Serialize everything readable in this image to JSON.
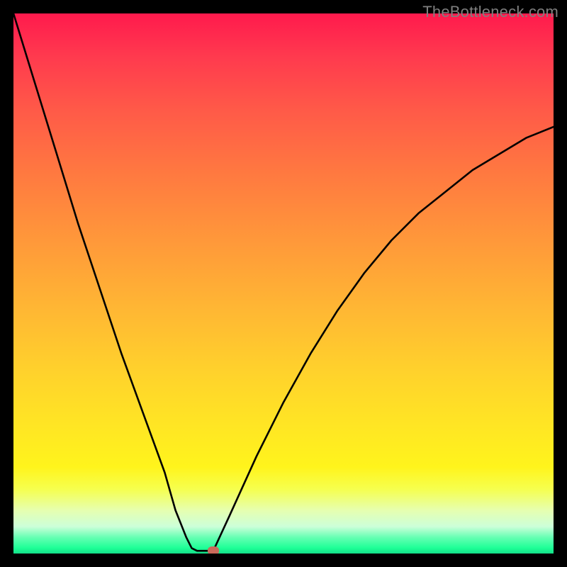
{
  "watermark": "TheBottleneck.com",
  "colors": {
    "frame_bg": "#000000",
    "gradient_top": "#ff1a4d",
    "gradient_bottom": "#13de88",
    "curve_stroke": "#000000",
    "marker_fill": "#c96a5a",
    "watermark_text": "#7f7f7f"
  },
  "chart_data": {
    "type": "line",
    "title": "",
    "xlabel": "",
    "ylabel": "",
    "xlim": [
      0,
      100
    ],
    "ylim": [
      0,
      100
    ],
    "grid": false,
    "legend_position": "none",
    "series": [
      {
        "name": "left-branch",
        "x": [
          0,
          4,
          8,
          12,
          16,
          20,
          24,
          28,
          30,
          32,
          33
        ],
        "y": [
          100,
          87,
          74,
          61,
          49,
          37,
          26,
          15,
          8,
          3,
          1
        ]
      },
      {
        "name": "flat-min",
        "x": [
          33,
          34,
          35,
          36,
          37
        ],
        "y": [
          1,
          0.5,
          0.5,
          0.5,
          0.5
        ]
      },
      {
        "name": "right-branch",
        "x": [
          37,
          40,
          45,
          50,
          55,
          60,
          65,
          70,
          75,
          80,
          85,
          90,
          95,
          100
        ],
        "y": [
          0.5,
          7,
          18,
          28,
          37,
          45,
          52,
          58,
          63,
          67,
          71,
          74,
          77,
          79
        ]
      }
    ],
    "annotations": [
      {
        "name": "min-marker",
        "x": 37,
        "y": 0.5
      }
    ]
  }
}
